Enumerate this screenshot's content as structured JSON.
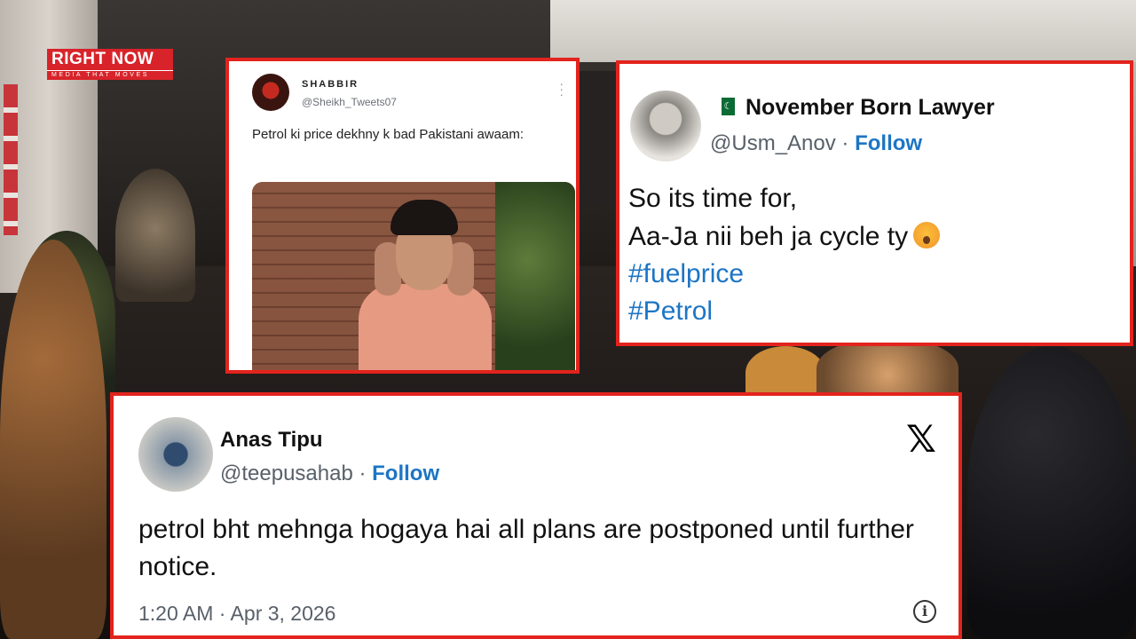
{
  "logo": {
    "brand": "RIGHT NOW",
    "tagline": "MEDIA THAT MOVES"
  },
  "tweets": [
    {
      "name": "SHABBIR",
      "handle": "@Sheikh_Tweets07",
      "text": "Petrol ki price dekhny k bad Pakistani awaam:",
      "has_image": true
    },
    {
      "name": "November Born Lawyer",
      "handle": "@Usm_Anov",
      "separator": " · ",
      "follow": "Follow",
      "lines": [
        "So its time for,",
        "Aa-Ja nii beh ja cycle ty"
      ],
      "hashtags": [
        "#fuelprice",
        "#Petrol"
      ]
    },
    {
      "name": "Anas Tipu",
      "handle": "@teepusahab",
      "separator": " · ",
      "follow": "Follow",
      "text": "petrol bht mehnga hogaya hai all plans are postponed until further notice.",
      "timestamp": "1:20 AM · Apr 3, 2026",
      "platform_icon": "x-logo-icon"
    }
  ],
  "colors": {
    "card_border": "#e3231d",
    "link": "#1d75c4",
    "logo_red": "#d8232a"
  }
}
